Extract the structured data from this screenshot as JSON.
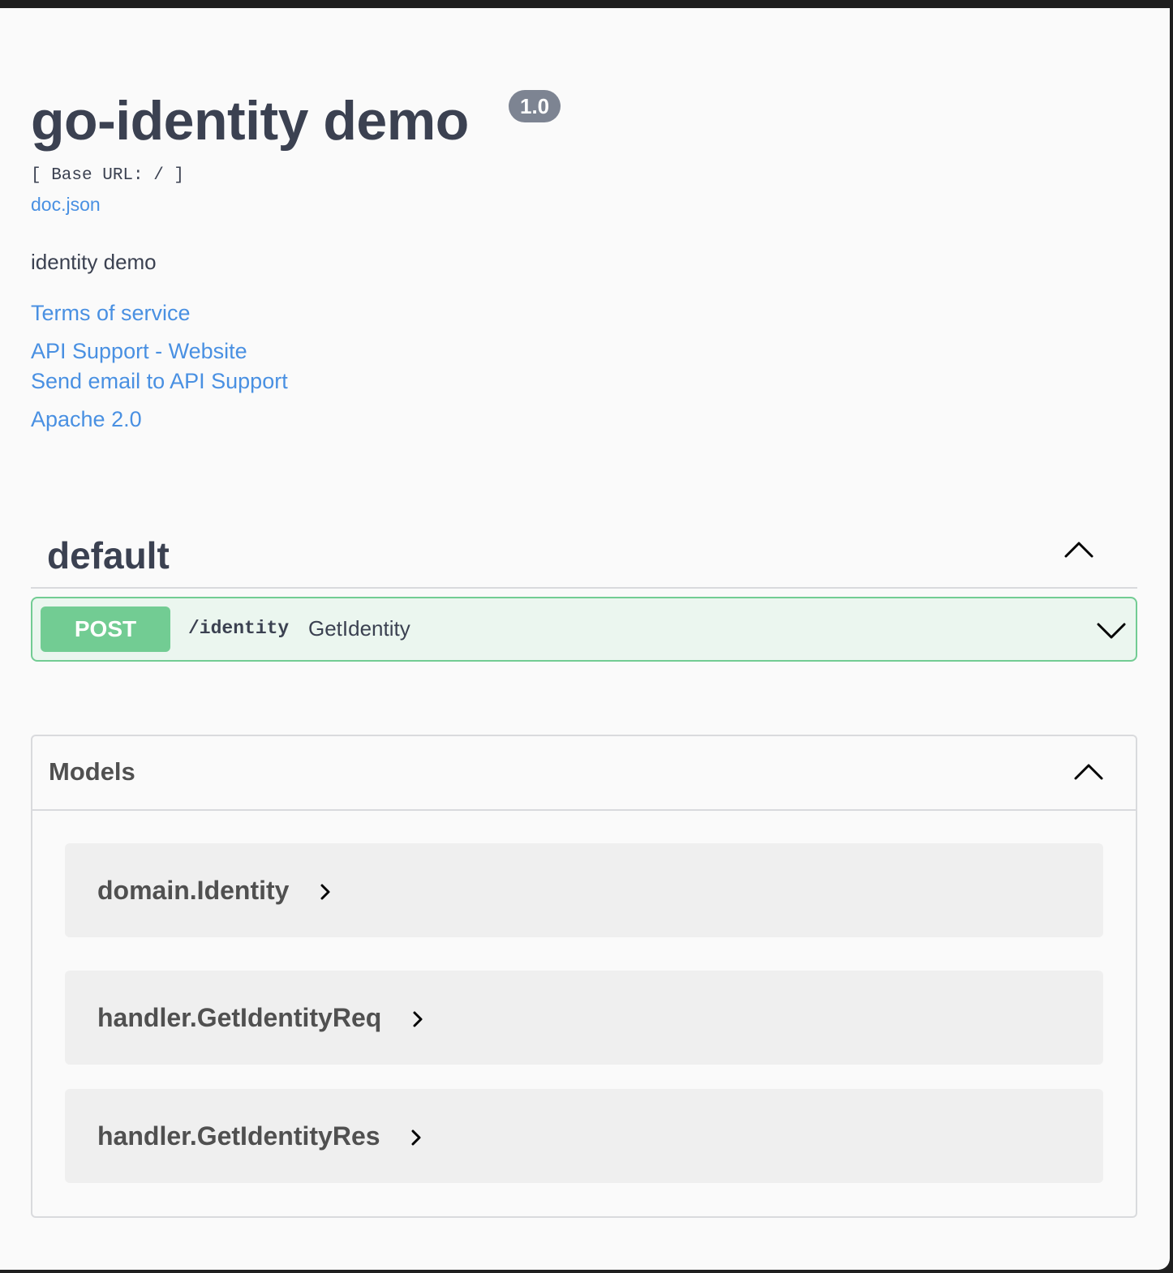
{
  "info": {
    "title": "go-identity demo",
    "version": "1.0",
    "base_url": "[ Base URL: / ]",
    "doc_link": "doc.json",
    "description": "identity demo",
    "links": {
      "terms": "Terms of service",
      "support_website": "API Support - Website",
      "support_email": "Send email to API Support",
      "license": "Apache 2.0"
    }
  },
  "tag": {
    "name": "default",
    "operations": [
      {
        "method": "POST",
        "path": "/identity",
        "summary": "GetIdentity"
      }
    ]
  },
  "models": {
    "title": "Models",
    "items": [
      {
        "name": "domain.Identity"
      },
      {
        "name": "handler.GetIdentityReq"
      },
      {
        "name": "handler.GetIdentityRes"
      }
    ]
  },
  "colors": {
    "post": "#72cc93",
    "post_bg": "#ebf6ef",
    "link": "#4990e2",
    "text": "#3b4151"
  },
  "icons": [
    "chevron-up-icon",
    "chevron-down-icon",
    "chevron-right-icon"
  ]
}
